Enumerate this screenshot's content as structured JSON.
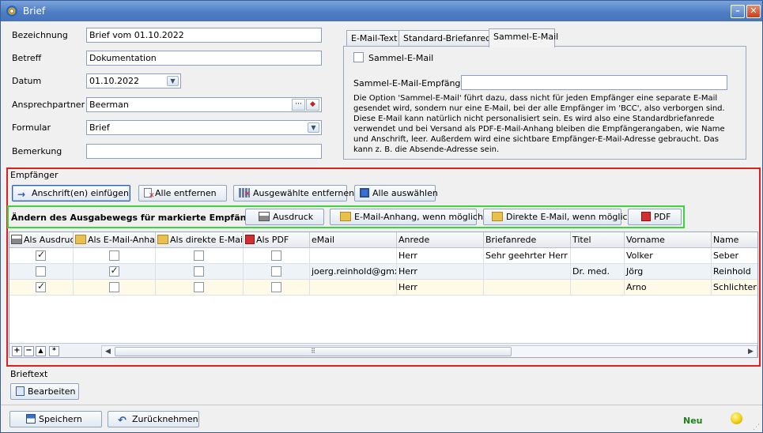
{
  "window": {
    "title": "Brief"
  },
  "form": {
    "bezeichnung_label": "Bezeichnung",
    "bezeichnung_value": "Brief vom 01.10.2022",
    "betreff_label": "Betreff",
    "betreff_value": "Dokumentation",
    "datum_label": "Datum",
    "datum_value": "01.10.2022",
    "ansprechpartner_label": "Ansprechpartner",
    "ansprechpartner_value": "Beerman",
    "formular_label": "Formular",
    "formular_value": "Brief",
    "bemerkung_label": "Bemerkung",
    "bemerkung_value": ""
  },
  "tabs": {
    "items": [
      "E-Mail-Text",
      "Standard-Briefanrede",
      "Sammel-E-Mail"
    ],
    "active": "Sammel-E-Mail",
    "sammel_checkbox_label": "Sammel-E-Mail",
    "empfaenger_label": "Sammel-E-Mail-Empfänger",
    "empfaenger_value": "",
    "info": "Die Option 'Sammel-E-Mail' führt dazu, dass nicht für jeden Empfänger eine separate E-Mail gesendet wird, sondern nur eine E-Mail, bei der alle Empfänger im 'BCC', also verborgen sind. Diese E-Mail kann natürlich nicht personalisiert sein. Es wird also eine Standardbriefanrede verwendet und bei Versand als PDF-E-Mail-Anhang bleiben die Empfängerangaben, wie Name und Anschrift, leer. Außerdem wird eine sichtbare Empfänger-E-Mail-Adresse gebraucht. Das kann z. B. die Absende-Adresse sein."
  },
  "empfaenger": {
    "group_label": "Empfänger",
    "btn_insert": "Anschrift(en) einfügen",
    "btn_remove_all": "Alle entfernen",
    "btn_remove_selected": "Ausgewählte entfernen",
    "btn_select_all": "Alle auswählen",
    "output_label": "Ändern des Ausgabewegs für markierte Empfänger",
    "btn_print": "Ausdruck",
    "btn_attach": "E-Mail-Anhang, wenn möglich",
    "btn_direct": "Direkte E-Mail, wenn möglich",
    "btn_pdf": "PDF"
  },
  "grid": {
    "columns": [
      "Als Ausdruck",
      "Als E-Mail-Anhang",
      "Als direkte E-Mail",
      "Als PDF",
      "eMail",
      "Anrede",
      "Briefanrede",
      "Titel",
      "Vorname",
      "Name"
    ],
    "rows": [
      {
        "ausdruck": true,
        "anhang": false,
        "direkt": false,
        "pdf": false,
        "email": "",
        "anrede": "Herr",
        "briefanrede": "Sehr geehrter Herr Vo",
        "titel": "",
        "vorname": "Volker",
        "name": "Seber"
      },
      {
        "ausdruck": false,
        "anhang": true,
        "direkt": false,
        "pdf": false,
        "email": "joerg.reinhold@gmx.d",
        "anrede": "Herr",
        "briefanrede": "",
        "titel": "Dr. med.",
        "vorname": "Jörg",
        "name": "Reinhold"
      },
      {
        "ausdruck": true,
        "anhang": false,
        "direkt": false,
        "pdf": false,
        "email": "",
        "anrede": "Herr",
        "briefanrede": "",
        "titel": "",
        "vorname": "Arno",
        "name": "Schlichter"
      }
    ]
  },
  "brieftext": {
    "label": "Brieftext",
    "btn_edit": "Bearbeiten"
  },
  "footer": {
    "btn_save": "Speichern",
    "btn_undo": "Zurücknehmen",
    "status": "Neu"
  },
  "colors": {
    "highlight_red": "#e02020",
    "highlight_green": "#3fd23f",
    "status_green": "#208020"
  }
}
